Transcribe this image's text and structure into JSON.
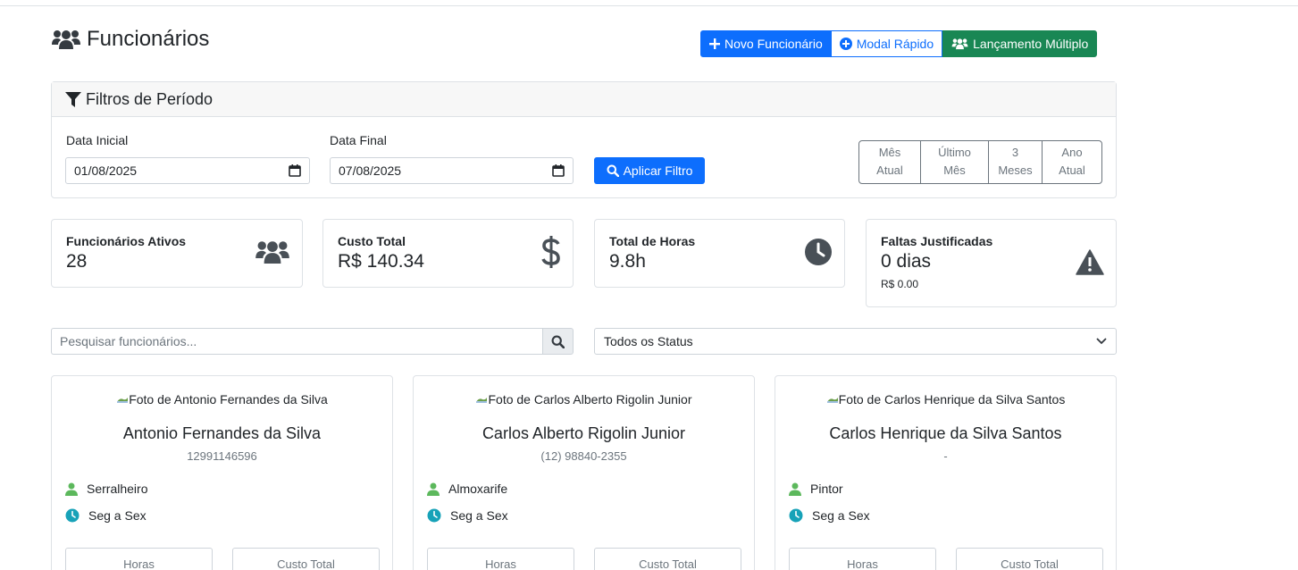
{
  "header": {
    "title": "Funcionários",
    "buttons": {
      "new_employee": "Novo Funcionário",
      "quick_modal": "Modal Rápido",
      "multiple_entry": "Lançamento Múltiplo"
    }
  },
  "filters": {
    "title": "Filtros de Período",
    "start_label": "Data Inicial",
    "start_value": "01/08/2025",
    "end_label": "Data Final",
    "end_value": "07/08/2025",
    "apply_label": "Aplicar Filtro",
    "periods": [
      {
        "line1": "Mês",
        "line2": "Atual"
      },
      {
        "line1": "Último",
        "line2": "Mês"
      },
      {
        "line1": "3",
        "line2": "Meses"
      },
      {
        "line1": "Ano",
        "line2": "Atual"
      }
    ]
  },
  "stats": {
    "active": {
      "label": "Funcionários Ativos",
      "value": "28"
    },
    "cost": {
      "label": "Custo Total",
      "value": "R$ 140.34"
    },
    "hours": {
      "label": "Total de Horas",
      "value": "9.8h"
    },
    "absences": {
      "label": "Faltas Justificadas",
      "value": "0 dias",
      "sub": "R$ 0.00"
    }
  },
  "search": {
    "placeholder": "Pesquisar funcionários...",
    "status_selected": "Todos os Status"
  },
  "employees": [
    {
      "photo_alt": "Foto de Antonio Fernandes da Silva",
      "name": "Antonio Fernandes da Silva",
      "phone": "12991146596",
      "role": "Serralheiro",
      "schedule": "Seg a Sex",
      "box1": "Horas",
      "box2": "Custo Total"
    },
    {
      "photo_alt": "Foto de Carlos Alberto Rigolin Junior",
      "name": "Carlos Alberto Rigolin Junior",
      "phone": "(12) 98840-2355",
      "role": "Almoxarife",
      "schedule": "Seg a Sex",
      "box1": "Horas",
      "box2": "Custo Total"
    },
    {
      "photo_alt": "Foto de Carlos Henrique da Silva Santos",
      "name": "Carlos Henrique da Silva Santos",
      "phone": "-",
      "role": "Pintor",
      "schedule": "Seg a Sex",
      "box1": "Horas",
      "box2": "Custo Total"
    }
  ],
  "colors": {
    "primary": "#0d6efd",
    "success": "#198754",
    "icon_gray": "#495057",
    "role_icon": "#5cb85c",
    "clock_icon": "#17a2b8"
  }
}
